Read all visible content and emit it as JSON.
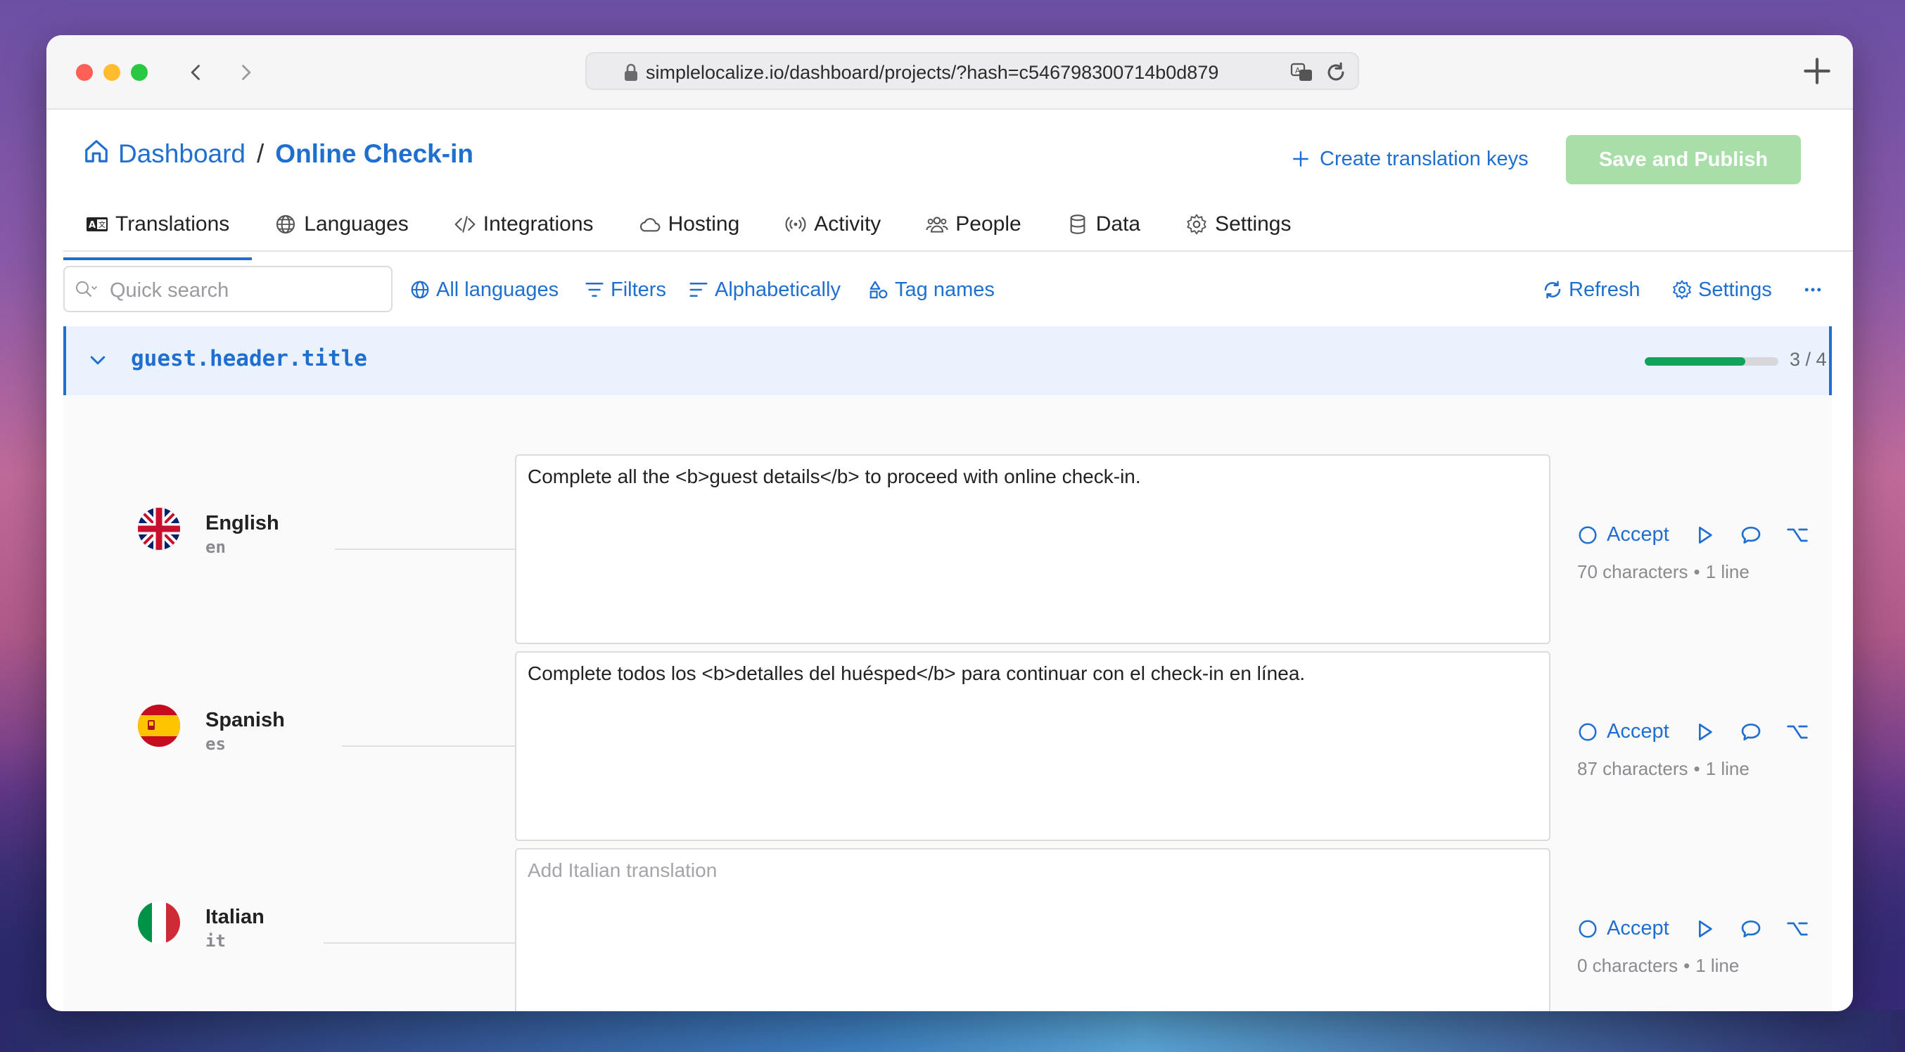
{
  "browser": {
    "url": "simplelocalize.io/dashboard/projects/?hash=c546798300714b0d879"
  },
  "breadcrumb": {
    "root": "Dashboard",
    "separator": "/",
    "current": "Online Check-in"
  },
  "header": {
    "create_keys_label": "Create translation keys",
    "save_label": "Save and Publish"
  },
  "tabs": [
    {
      "label": "Translations",
      "icon": "translate-icon",
      "active": true
    },
    {
      "label": "Languages",
      "icon": "globe-icon"
    },
    {
      "label": "Integrations",
      "icon": "code-icon"
    },
    {
      "label": "Hosting",
      "icon": "cloud-icon"
    },
    {
      "label": "Activity",
      "icon": "broadcast-icon"
    },
    {
      "label": "People",
      "icon": "people-icon"
    },
    {
      "label": "Data",
      "icon": "database-icon"
    },
    {
      "label": "Settings",
      "icon": "gear-icon"
    }
  ],
  "toolbar": {
    "search_placeholder": "Quick search",
    "all_languages": "All languages",
    "filters": "Filters",
    "sort": "Alphabetically",
    "tag_names": "Tag names",
    "refresh": "Refresh",
    "settings": "Settings"
  },
  "key": {
    "name": "guest.header.title",
    "progress_text": "3 / 4",
    "progress_fraction": 0.75
  },
  "translations": [
    {
      "language": "English",
      "code": "en",
      "text": "Complete all the <b>guest details</b> to proceed with online check-in.",
      "placeholder": "",
      "accept_label": "Accept",
      "characters": "70 characters",
      "lines": "1 line"
    },
    {
      "language": "Spanish",
      "code": "es",
      "text": "Complete todos los <b>detalles del huésped</b> para continuar con el check-in en línea.",
      "placeholder": "",
      "accept_label": "Accept",
      "characters": "87 characters",
      "lines": "1 line"
    },
    {
      "language": "Italian",
      "code": "it",
      "text": "",
      "placeholder": "Add Italian translation",
      "accept_label": "Accept",
      "characters": "0 characters",
      "lines": "1 line"
    }
  ],
  "colors": {
    "accent": "#1f6fd1",
    "save_button": "#a8dea8",
    "progress": "#12a35a",
    "key_row_bg": "#eaf3fd"
  }
}
